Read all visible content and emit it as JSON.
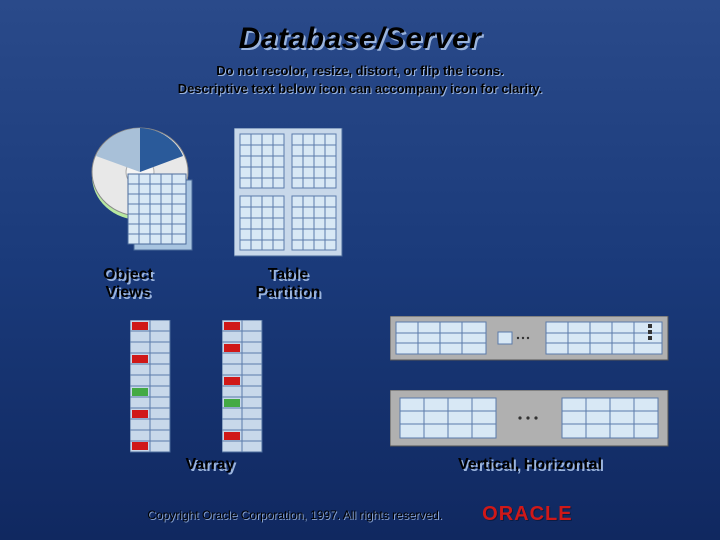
{
  "slide": {
    "title": "Database/Server",
    "subtitle_line1": "Do not recolor, resize, distort, or flip the icons.",
    "subtitle_line2": "Descriptive text below icon can accompany icon for clarity."
  },
  "labels": {
    "object_views": "Object\nViews",
    "table_partition": "Table\nPartition",
    "varray": "Varray",
    "vertical_horizontal": "Vertical, Horizontal"
  },
  "footer": {
    "copyright": "Copyright  Oracle Corporation, 1997. All rights reserved.",
    "logo": "ORACLE"
  },
  "colors": {
    "accent_red": "#d01818",
    "dot_green": "#44aa44",
    "cell_blue": "#7aa4d4"
  }
}
